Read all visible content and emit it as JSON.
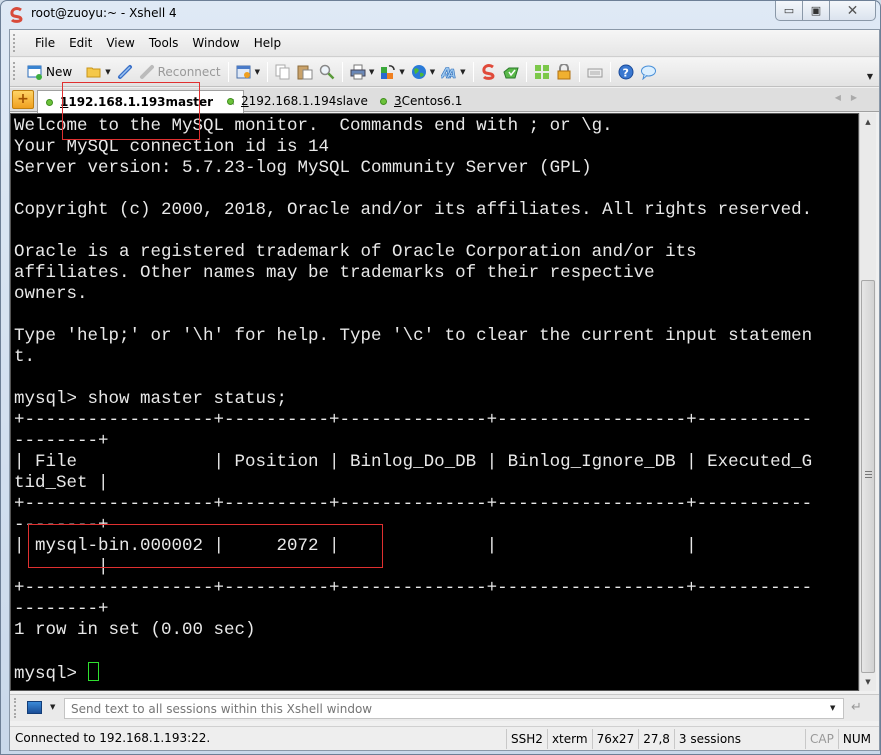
{
  "window": {
    "title": "root@zuoyu:~ - Xshell 4",
    "controls": {
      "minimize": "▭",
      "maximize": "▣",
      "close": "✕"
    }
  },
  "menubar": {
    "items": [
      "File",
      "Edit",
      "View",
      "Tools",
      "Window",
      "Help"
    ]
  },
  "toolbar": {
    "new_label": "New",
    "reconnect_label": "Reconnect",
    "icons": [
      "new-session-icon",
      "open-folder-icon",
      "connect-icon",
      "reconnect-icon",
      "properties-icon",
      "copy-icon",
      "paste-icon",
      "find-icon",
      "print-icon",
      "transfer-icon",
      "globe-icon",
      "font-icon",
      "xshell-logo-icon",
      "xftp-icon",
      "fullscreen-icon",
      "lock-icon",
      "keyboard-icon",
      "help-icon",
      "chat-icon"
    ]
  },
  "tabs": [
    {
      "number": "1",
      "label": " 192.168.1.193master",
      "active": true,
      "status_color": "#6cc23a"
    },
    {
      "number": "2",
      "label": " 192.168.1.194slave",
      "active": false,
      "status_color": "#6cc23a"
    },
    {
      "number": "3",
      "label": " Centos6.1",
      "active": false,
      "status_color": "#6cc23a"
    }
  ],
  "tab_close": "×",
  "terminal": {
    "lines": [
      "Welcome to the MySQL monitor.  Commands end with ; or \\g.",
      "Your MySQL connection id is 14",
      "Server version: 5.7.23-log MySQL Community Server (GPL)",
      "",
      "Copyright (c) 2000, 2018, Oracle and/or its affiliates. All rights reserved.",
      "",
      "Oracle is a registered trademark of Oracle Corporation and/or its",
      "affiliates. Other names may be trademarks of their respective",
      "owners.",
      "",
      "Type 'help;' or '\\h' for help. Type '\\c' to clear the current input statemen",
      "t.",
      "",
      "mysql> show master status;",
      "+------------------+----------+--------------+------------------+-----------",
      "--------+",
      "| File             | Position | Binlog_Do_DB | Binlog_Ignore_DB | Executed_G",
      "tid_Set |",
      "+------------------+----------+--------------+------------------+-----------",
      "--------+",
      "| mysql-bin.000002 |     2072 |              |                  |",
      "        |",
      "+------------------+----------+--------------+------------------+-----------",
      "--------+",
      "1 row in set (0.00 sec)",
      ""
    ],
    "prompt": "mysql> ",
    "accent_cursor": "#2fe02f"
  },
  "sendbar": {
    "placeholder": "Send text to all sessions within this Xshell window"
  },
  "statusbar": {
    "connection": "Connected to 192.168.1.193:22.",
    "protocol": "SSH2",
    "terminal_type": "xterm",
    "size": "76x27",
    "cursor_pos": "27,8",
    "sessions": "3 sessions",
    "cap": "CAP",
    "num": "NUM"
  }
}
